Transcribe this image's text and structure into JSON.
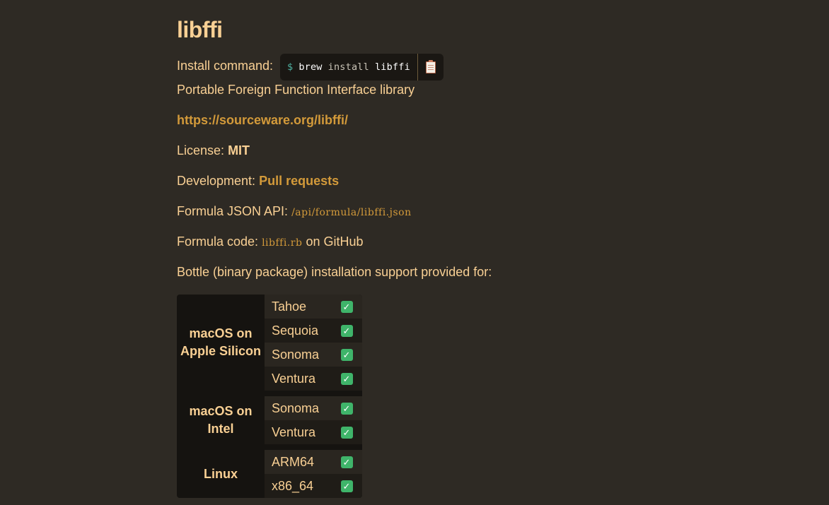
{
  "title": "libffi",
  "install": {
    "label": "Install command:",
    "prompt": "$",
    "cmd": "brew",
    "subcmd": "install",
    "package": "libffi",
    "copy_icon": "clipboard-icon"
  },
  "description": "Portable Foreign Function Interface library",
  "homepage": "https://sourceware.org/libffi/",
  "license": {
    "label": "License:",
    "value": "MIT"
  },
  "development": {
    "label": "Development:",
    "link": "Pull requests"
  },
  "api": {
    "label": "Formula JSON API:",
    "path": "/api/formula/libffi.json"
  },
  "code": {
    "label": "Formula code:",
    "file": "libffi.rb",
    "suffix": "on GitHub"
  },
  "bottle_text": "Bottle (binary package) installation support provided for:",
  "bottles": {
    "groups": [
      {
        "name_line1": "macOS on",
        "name_line2": "Apple Silicon",
        "items": [
          "Tahoe",
          "Sequoia",
          "Sonoma",
          "Ventura"
        ]
      },
      {
        "name_line1": "macOS on",
        "name_line2": "Intel",
        "items": [
          "Sonoma",
          "Ventura"
        ]
      },
      {
        "name_line1": "Linux",
        "name_line2": "",
        "items": [
          "ARM64",
          "x86_64"
        ]
      }
    ],
    "check_icon": "check-mark-icon",
    "check_color": "#3fb46a"
  },
  "colors": {
    "background": "#2e2a24",
    "text": "#f9d094",
    "link": "#d39a3a"
  }
}
